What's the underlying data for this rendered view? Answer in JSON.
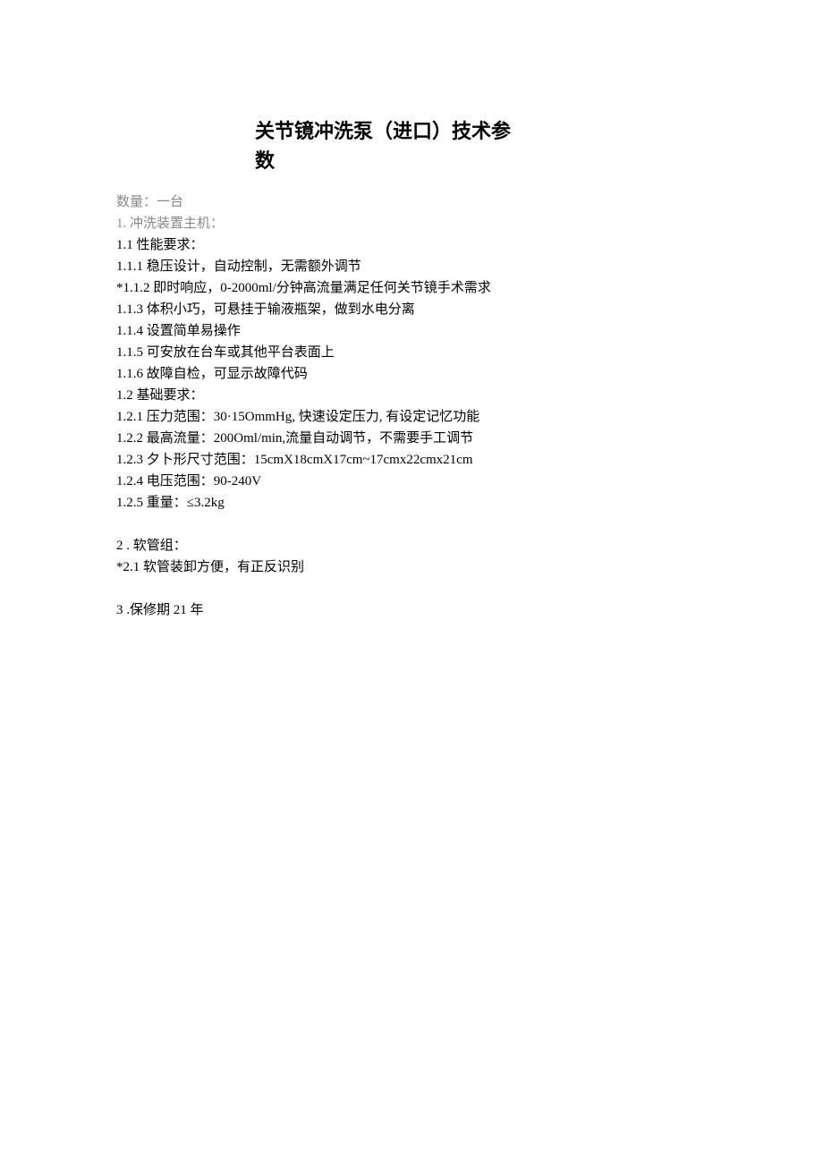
{
  "title": {
    "line1": "关节镜冲洗泵（进口）技术参",
    "line2": "数"
  },
  "lines": [
    {
      "text": "数量：一台",
      "gray": true
    },
    {
      "text": "1. 冲洗装置主机：",
      "gray": true
    },
    {
      "text": "1.1   性能要求：",
      "gray": false
    },
    {
      "text": "1.1.1   稳压设计，自动控制，无需额外调节",
      "gray": false
    },
    {
      "text": "*1.1.2 即时响应，0-2000ml/分钟高流量满足任何关节镜手术需求",
      "gray": false
    },
    {
      "text": "1.1.3   体积小巧，可悬挂于输液瓶架，做到水电分离",
      "gray": false
    },
    {
      "text": "1.1.4   设置简单易操作",
      "gray": false
    },
    {
      "text": "1.1.5   可安放在台车或其他平台表面上",
      "gray": false
    },
    {
      "text": "1.1.6   故障自检，可显示故障代码",
      "gray": false
    },
    {
      "text": "1.2   基础要求：",
      "gray": false
    },
    {
      "text": "1.2.1   压力范围：30·15OmmHg, 快速设定压力, 有设定记忆功能",
      "gray": false
    },
    {
      "text": "1.2.2   最高流量：200Oml/min,流量自动调节，不需要手工调节",
      "gray": false
    },
    {
      "text": "1.2.3   夕卜形尺寸范围：15cmX18cmX17cm~17cmx22cmx21cm",
      "gray": false
    },
    {
      "text": "1.2.4   电压范围：90-240V",
      "gray": false
    },
    {
      "text": "1.2.5   重量：≤3.2kg",
      "gray": false
    },
    {
      "text": "",
      "gray": false
    },
    {
      "text": "2  . 软管组：",
      "gray": false
    },
    {
      "text": "*2.1 软管装卸方便，有正反识别",
      "gray": false
    },
    {
      "text": "",
      "gray": false
    },
    {
      "text": "3  .保修期 21 年",
      "gray": false
    }
  ]
}
